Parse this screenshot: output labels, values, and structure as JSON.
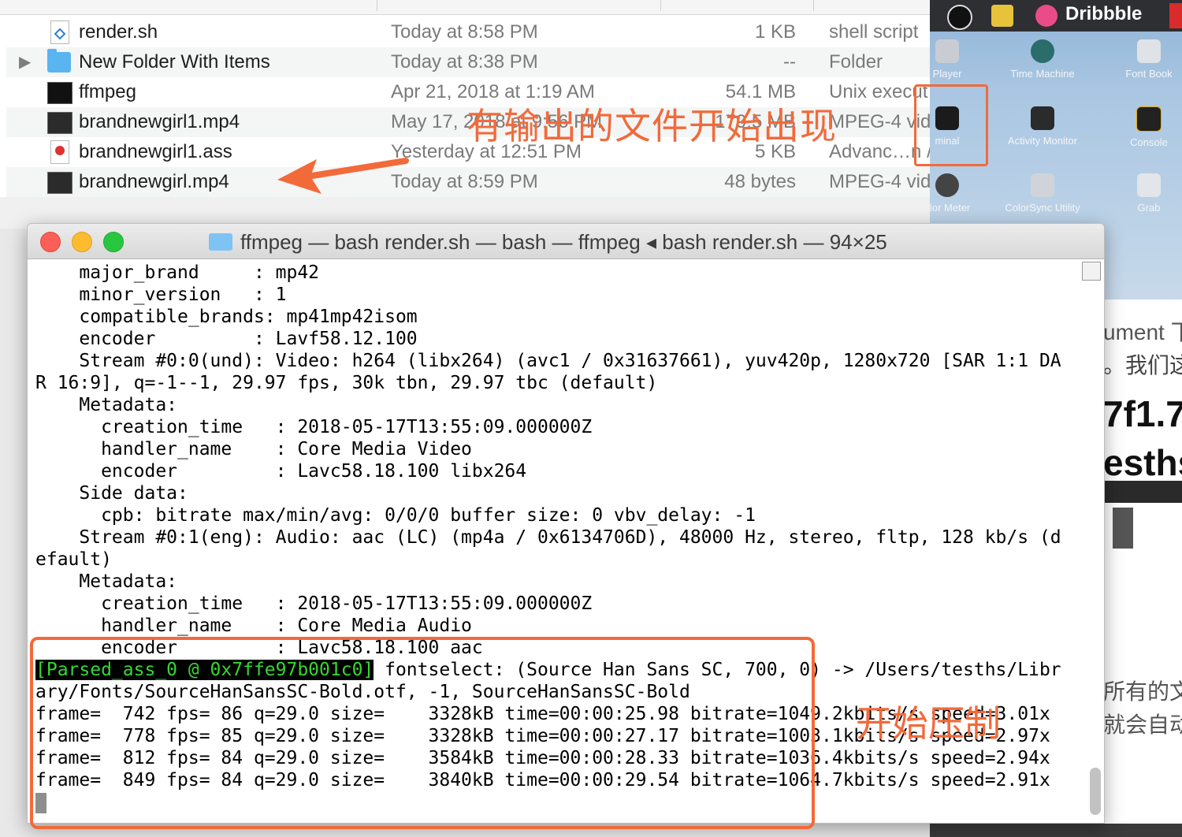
{
  "finder": {
    "files": [
      {
        "name": "render.sh",
        "date": "Today at 8:58 PM",
        "size": "1 KB",
        "kind": "shell script",
        "icon": "script-file-icon",
        "expandable": false
      },
      {
        "name": "New Folder With Items",
        "date": "Today at 8:38 PM",
        "size": "--",
        "kind": "Folder",
        "icon": "folder-icon",
        "expandable": true
      },
      {
        "name": "ffmpeg",
        "date": "Apr 21, 2018 at 1:19 AM",
        "size": "54.1 MB",
        "kind": "Unix execut",
        "icon": "executable-icon",
        "expandable": false
      },
      {
        "name": "brandnewgirl1.mp4",
        "date": "May 17, 2018 at 9:56 PM",
        "size": "179.5 MB",
        "kind": "MPEG-4 vid",
        "icon": "video-file-icon",
        "expandable": false
      },
      {
        "name": "brandnewgirl1.ass",
        "date": "Yesterday at 12:51 PM",
        "size": "5 KB",
        "kind": "Advanc…n /",
        "icon": "ass-file-icon",
        "expandable": false
      },
      {
        "name": "brandnewgirl.mp4",
        "date": "Today at 8:59 PM",
        "size": "48 bytes",
        "kind": "MPEG-4 vid",
        "icon": "video-file-icon",
        "expandable": false
      }
    ]
  },
  "annotations": {
    "top": "有输出的文件开始出现",
    "bottom": "开始压制",
    "color": "#f26a3a"
  },
  "menubar": {
    "app_label": "Dribbble"
  },
  "launchpad": {
    "apps": [
      {
        "label": "Player"
      },
      {
        "label": "Time Machine"
      },
      {
        "label": "Font Book"
      },
      {
        "label": "minal"
      },
      {
        "label": "Activity Monitor"
      },
      {
        "label": "Console"
      },
      {
        "label": "olor Meter"
      },
      {
        "label": "ColorSync Utility"
      },
      {
        "label": "Grab"
      }
    ]
  },
  "background_doc": {
    "snippets": [
      "ument 下",
      "。我们这",
      "7f1.7",
      "esths",
      "所有的文",
      "就会自动"
    ]
  },
  "terminal": {
    "title": "ffmpeg — bash render.sh — bash — ffmpeg ◂ bash render.sh — 94×25",
    "lines": [
      "    major_brand     : mp42",
      "    minor_version   : 1",
      "    compatible_brands: mp41mp42isom",
      "    encoder         : Lavf58.12.100",
      "    Stream #0:0(und): Video: h264 (libx264) (avc1 / 0x31637661), yuv420p, 1280x720 [SAR 1:1 DA",
      "R 16:9], q=-1--1, 29.97 fps, 30k tbn, 29.97 tbc (default)",
      "    Metadata:",
      "      creation_time   : 2018-05-17T13:55:09.000000Z",
      "      handler_name    : Core Media Video",
      "      encoder         : Lavc58.18.100 libx264",
      "    Side data:",
      "      cpb: bitrate max/min/avg: 0/0/0 buffer size: 0 vbv_delay: -1",
      "    Stream #0:1(eng): Audio: aac (LC) (mp4a / 0x6134706D), 48000 Hz, stereo, fltp, 128 kb/s (d",
      "efault)",
      "    Metadata:",
      "      creation_time   : 2018-05-17T13:55:09.000000Z",
      "      handler_name    : Core Media Audio",
      "      encoder         : Lavc58.18.100 aac"
    ],
    "parsed_tag": "[Parsed_ass_0 @ 0x7ffe97b001c0]",
    "parsed_rest": " fontselect: (Source Han Sans SC, 700, 0) -> /Users/tesths/Libr",
    "parsed_cont": "ary/Fonts/SourceHanSansSC-Bold.otf, -1, SourceHanSansSC-Bold",
    "progress": [
      "frame=  742 fps= 86 q=29.0 size=    3328kB time=00:00:25.98 bitrate=1049.2kbits/s speed=3.01x",
      "frame=  778 fps= 85 q=29.0 size=    3328kB time=00:00:27.17 bitrate=1003.1kbits/s speed=2.97x",
      "frame=  812 fps= 84 q=29.0 size=    3584kB time=00:00:28.33 bitrate=1036.4kbits/s speed=2.94x",
      "frame=  849 fps= 84 q=29.0 size=    3840kB time=00:00:29.54 bitrate=1064.7kbits/s speed=2.91x"
    ]
  }
}
